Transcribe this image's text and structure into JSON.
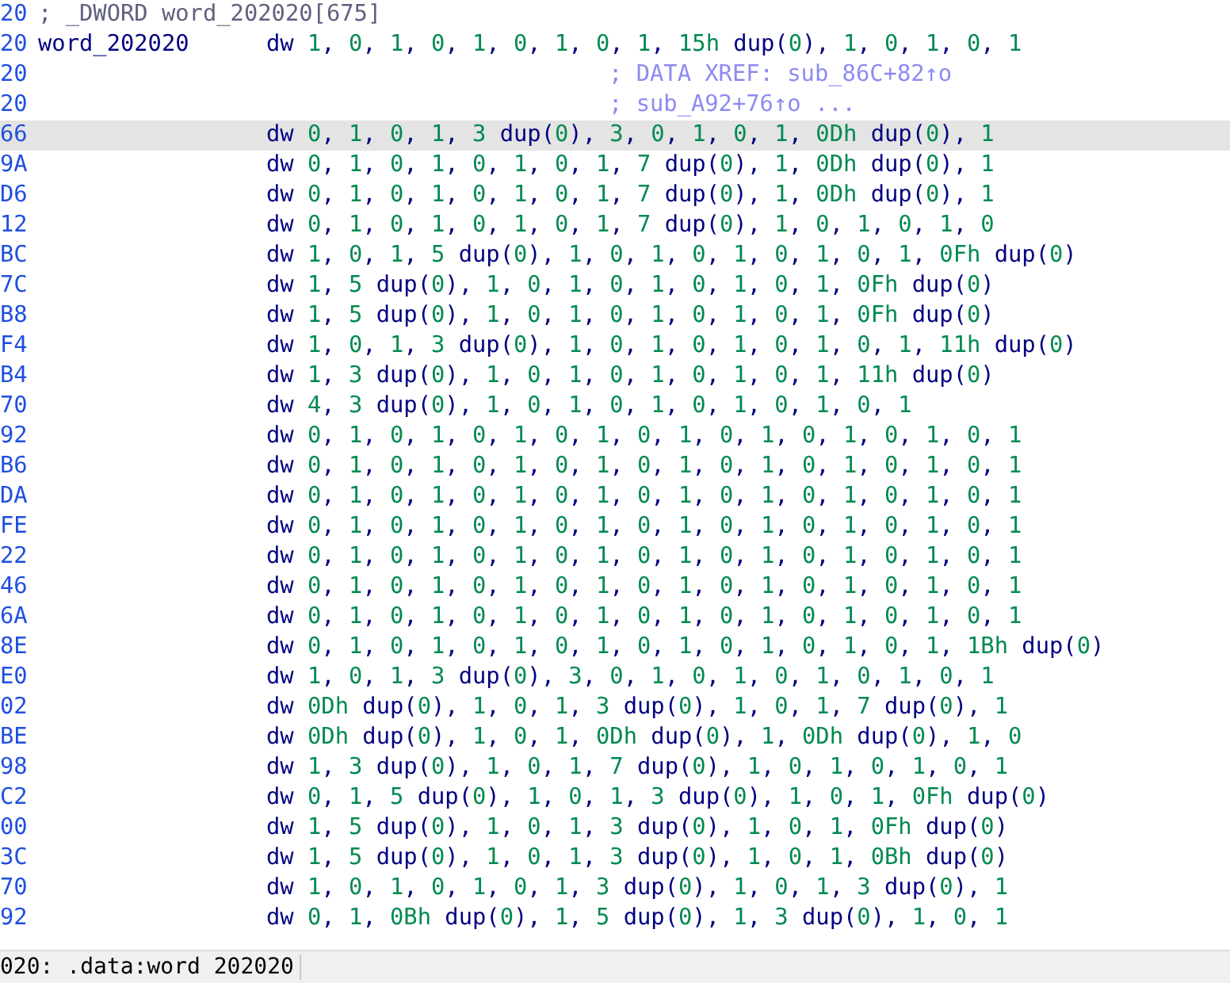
{
  "listing": [
    {
      "address": "20",
      "comment": "; _DWORD word_202020[675]",
      "kind": "header",
      "selected": false
    },
    {
      "address": "20",
      "label": "word_202020",
      "directive": "dw",
      "operands": "1, 0, 1, 0, 1, 0, 1, 0, 1, 15h dup(0), 1, 0, 1, 0, 1",
      "kind": "data",
      "selected": false
    },
    {
      "address": "20",
      "comment": "; DATA XREF: sub_86C+82↑o",
      "kind": "xref",
      "selected": false
    },
    {
      "address": "20",
      "comment": "; sub_A92+76↑o ...",
      "kind": "xref",
      "selected": false
    },
    {
      "address": "66",
      "directive": "dw",
      "operands": "0, 1, 0, 1, 3 dup(0), 3, 0, 1, 0, 1, 0Dh dup(0), 1",
      "kind": "data",
      "selected": true
    },
    {
      "address": "9A",
      "directive": "dw",
      "operands": "0, 1, 0, 1, 0, 1, 0, 1, 7 dup(0), 1, 0Dh dup(0), 1",
      "kind": "data",
      "selected": false
    },
    {
      "address": "D6",
      "directive": "dw",
      "operands": "0, 1, 0, 1, 0, 1, 0, 1, 7 dup(0), 1, 0Dh dup(0), 1",
      "kind": "data",
      "selected": false
    },
    {
      "address": "12",
      "directive": "dw",
      "operands": "0, 1, 0, 1, 0, 1, 0, 1, 7 dup(0), 1, 0, 1, 0, 1, 0",
      "kind": "data",
      "selected": false
    },
    {
      "address": "BC",
      "directive": "dw",
      "operands": "1, 0, 1, 5 dup(0), 1, 0, 1, 0, 1, 0, 1, 0, 1, 0Fh dup(0)",
      "kind": "data",
      "selected": false
    },
    {
      "address": "7C",
      "directive": "dw",
      "operands": "1, 5 dup(0), 1, 0, 1, 0, 1, 0, 1, 0, 1, 0Fh dup(0)",
      "kind": "data",
      "selected": false
    },
    {
      "address": "B8",
      "directive": "dw",
      "operands": "1, 5 dup(0), 1, 0, 1, 0, 1, 0, 1, 0, 1, 0Fh dup(0)",
      "kind": "data",
      "selected": false
    },
    {
      "address": "F4",
      "directive": "dw",
      "operands": "1, 0, 1, 3 dup(0), 1, 0, 1, 0, 1, 0, 1, 0, 1, 11h dup(0)",
      "kind": "data",
      "selected": false
    },
    {
      "address": "B4",
      "directive": "dw",
      "operands": "1, 3 dup(0), 1, 0, 1, 0, 1, 0, 1, 0, 1, 11h dup(0)",
      "kind": "data",
      "selected": false
    },
    {
      "address": "70",
      "directive": "dw",
      "operands": "4, 3 dup(0), 1, 0, 1, 0, 1, 0, 1, 0, 1, 0, 1",
      "kind": "data",
      "selected": false
    },
    {
      "address": "92",
      "directive": "dw",
      "operands": "0, 1, 0, 1, 0, 1, 0, 1, 0, 1, 0, 1, 0, 1, 0, 1, 0, 1",
      "kind": "data",
      "selected": false
    },
    {
      "address": "B6",
      "directive": "dw",
      "operands": "0, 1, 0, 1, 0, 1, 0, 1, 0, 1, 0, 1, 0, 1, 0, 1, 0, 1",
      "kind": "data",
      "selected": false
    },
    {
      "address": "DA",
      "directive": "dw",
      "operands": "0, 1, 0, 1, 0, 1, 0, 1, 0, 1, 0, 1, 0, 1, 0, 1, 0, 1",
      "kind": "data",
      "selected": false
    },
    {
      "address": "FE",
      "directive": "dw",
      "operands": "0, 1, 0, 1, 0, 1, 0, 1, 0, 1, 0, 1, 0, 1, 0, 1, 0, 1",
      "kind": "data",
      "selected": false
    },
    {
      "address": "22",
      "directive": "dw",
      "operands": "0, 1, 0, 1, 0, 1, 0, 1, 0, 1, 0, 1, 0, 1, 0, 1, 0, 1",
      "kind": "data",
      "selected": false
    },
    {
      "address": "46",
      "directive": "dw",
      "operands": "0, 1, 0, 1, 0, 1, 0, 1, 0, 1, 0, 1, 0, 1, 0, 1, 0, 1",
      "kind": "data",
      "selected": false
    },
    {
      "address": "6A",
      "directive": "dw",
      "operands": "0, 1, 0, 1, 0, 1, 0, 1, 0, 1, 0, 1, 0, 1, 0, 1, 0, 1",
      "kind": "data",
      "selected": false
    },
    {
      "address": "8E",
      "directive": "dw",
      "operands": "0, 1, 0, 1, 0, 1, 0, 1, 0, 1, 0, 1, 0, 1, 0, 1, 1Bh dup(0)",
      "kind": "data",
      "selected": false
    },
    {
      "address": "E0",
      "directive": "dw",
      "operands": "1, 0, 1, 3 dup(0), 3, 0, 1, 0, 1, 0, 1, 0, 1, 0, 1",
      "kind": "data",
      "selected": false
    },
    {
      "address": "02",
      "directive": "dw",
      "operands": "0Dh dup(0), 1, 0, 1, 3 dup(0), 1, 0, 1, 7 dup(0), 1",
      "kind": "data",
      "selected": false
    },
    {
      "address": "BE",
      "directive": "dw",
      "operands": "0Dh dup(0), 1, 0, 1, 0Dh dup(0), 1, 0Dh dup(0), 1, 0",
      "kind": "data",
      "selected": false
    },
    {
      "address": "98",
      "directive": "dw",
      "operands": "1, 3 dup(0), 1, 0, 1, 7 dup(0), 1, 0, 1, 0, 1, 0, 1",
      "kind": "data",
      "selected": false
    },
    {
      "address": "C2",
      "directive": "dw",
      "operands": "0, 1, 5 dup(0), 1, 0, 1, 3 dup(0), 1, 0, 1, 0Fh dup(0)",
      "kind": "data",
      "selected": false
    },
    {
      "address": "00",
      "directive": "dw",
      "operands": "1, 5 dup(0), 1, 0, 1, 3 dup(0), 1, 0, 1, 0Fh dup(0)",
      "kind": "data",
      "selected": false
    },
    {
      "address": "3C",
      "directive": "dw",
      "operands": "1, 5 dup(0), 1, 0, 1, 3 dup(0), 1, 0, 1, 0Bh dup(0)",
      "kind": "data",
      "selected": false
    },
    {
      "address": "70",
      "directive": "dw",
      "operands": "1, 0, 1, 0, 1, 0, 1, 3 dup(0), 1, 0, 1, 3 dup(0), 1",
      "kind": "data",
      "selected": false
    },
    {
      "address": "92",
      "directive": "dw",
      "operands": "0, 1, 0Bh dup(0), 1, 5 dup(0), 1, 3 dup(0), 1, 0, 1",
      "kind": "data",
      "selected": false
    }
  ],
  "status_bar": {
    "text": "020: .data:word 202020"
  }
}
